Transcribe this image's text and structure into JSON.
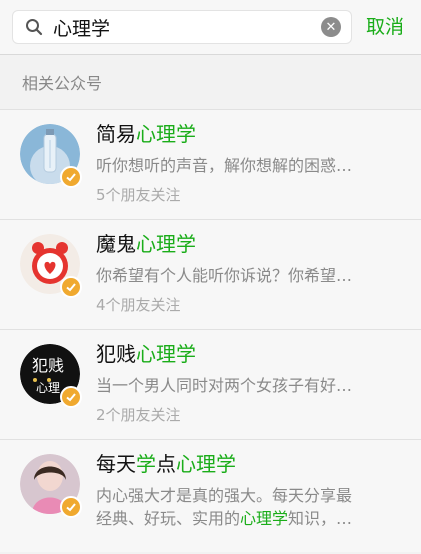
{
  "colors": {
    "accent": "#1aad19",
    "verified": "#f0a92f"
  },
  "search": {
    "query": "心理学",
    "cancel_label": "取消"
  },
  "section_title": "相关公众号",
  "accounts": [
    {
      "name_prefix": "简易",
      "name_highlight": "心理学",
      "desc": "听你想听的声音，解你想解的困惑…",
      "friends": "5个朋友关注"
    },
    {
      "name_prefix": "魔鬼",
      "name_highlight": "心理学",
      "desc": "你希望有个人能听你诉说？你希望…",
      "friends": "4个朋友关注"
    },
    {
      "name_prefix": "犯贱",
      "name_highlight": "心理学",
      "avatar_text_top": "犯贱",
      "avatar_text_bottom": "心理",
      "desc": "当一个男人同时对两个女孩子有好…",
      "friends": "2个朋友关注"
    },
    {
      "name_prefix": "每天",
      "name_highlight_1": "学",
      "name_mid": "点",
      "name_highlight": "心理学",
      "desc_line1": "内心强大才是真的强大。每天分享最",
      "desc_line2_prefix": "经典、好玩、实用的",
      "desc_line2_highlight": "心理学",
      "desc_line2_suffix": "知识，…"
    }
  ]
}
